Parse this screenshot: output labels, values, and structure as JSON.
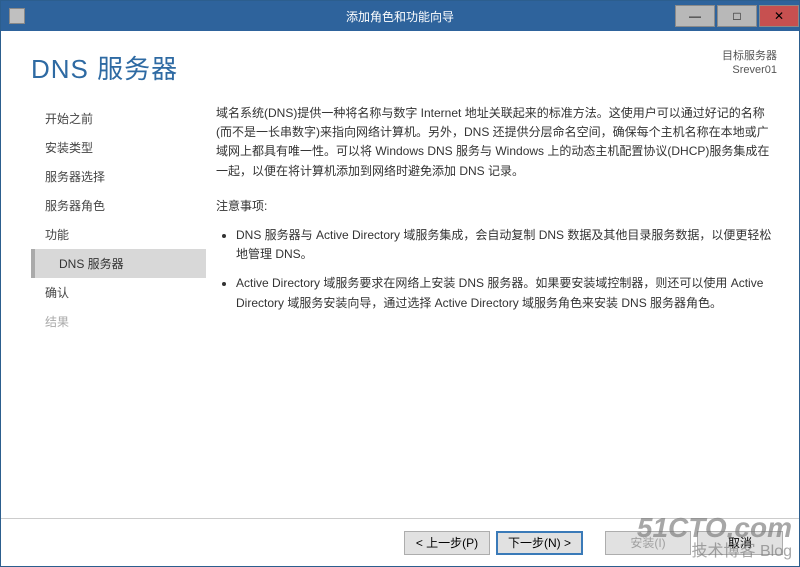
{
  "titlebar": {
    "title": "添加角色和功能向导"
  },
  "header": {
    "page_title": "DNS 服务器",
    "target_label": "目标服务器",
    "target_name": "Srever01"
  },
  "nav": {
    "items": [
      {
        "label": "开始之前",
        "state": "normal"
      },
      {
        "label": "安装类型",
        "state": "normal"
      },
      {
        "label": "服务器选择",
        "state": "normal"
      },
      {
        "label": "服务器角色",
        "state": "normal"
      },
      {
        "label": "功能",
        "state": "normal"
      },
      {
        "label": "DNS 服务器",
        "state": "active"
      },
      {
        "label": "确认",
        "state": "normal"
      },
      {
        "label": "结果",
        "state": "disabled"
      }
    ]
  },
  "main": {
    "intro": "域名系统(DNS)提供一种将名称与数字 Internet 地址关联起来的标准方法。这使用户可以通过好记的名称(而不是一长串数字)来指向网络计算机。另外，DNS 还提供分层命名空间，确保每个主机名称在本地或广域网上都具有唯一性。可以将 Windows DNS 服务与 Windows 上的动态主机配置协议(DHCP)服务集成在一起，以便在将计算机添加到网络时避免添加 DNS 记录。",
    "notes_label": "注意事项:",
    "notes": [
      "DNS 服务器与 Active Directory 域服务集成，会自动复制 DNS 数据及其他目录服务数据，以便更轻松地管理 DNS。",
      "Active Directory 域服务要求在网络上安装 DNS 服务器。如果要安装域控制器，则还可以使用 Active Directory 域服务安装向导，通过选择 Active Directory 域服务角色来安装 DNS 服务器角色。"
    ]
  },
  "footer": {
    "prev": "< 上一步(P)",
    "next": "下一步(N) >",
    "install": "安装(I)",
    "cancel": "取消"
  },
  "watermark": {
    "line1": "51CTO.com",
    "line2": "技术博客 Blog"
  }
}
